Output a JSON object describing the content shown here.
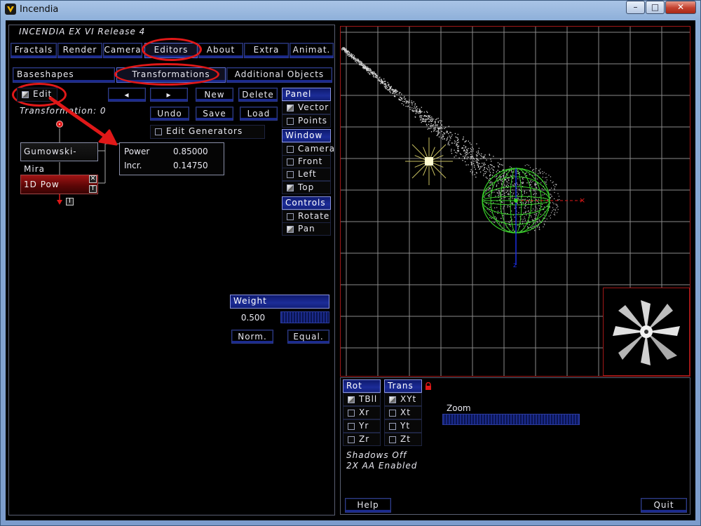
{
  "window": {
    "title": "Incendia",
    "minimize": "–",
    "maximize": "□",
    "close": "✕"
  },
  "app": {
    "title": "INCENDIA EX VI   Release 4"
  },
  "menu": [
    "Fractals",
    "Render",
    "Camera",
    "Editors",
    "About",
    "Extra",
    "Animat."
  ],
  "subtabs": [
    "Baseshapes",
    "Transformations",
    "Additional Objects"
  ],
  "toolbar": {
    "edit": "Edit",
    "prev": "◂",
    "next": "▸",
    "new": "New",
    "delete": "Delete",
    "undo": "Undo",
    "save": "Save",
    "load": "Load",
    "edit_generators": "Edit Generators"
  },
  "transformation": {
    "label": "Transformation: 0",
    "generator": "Gumowski-Mira",
    "node": "1D Pow",
    "node_x": "✕",
    "node_t": "T",
    "out_i": "I"
  },
  "params": {
    "power_label": "Power",
    "power_value": "0.85000",
    "incr_label": "Incr.",
    "incr_value": "0.14750"
  },
  "panel": {
    "header": "Panel",
    "items": [
      "Vector",
      "Points"
    ],
    "checked": [
      true,
      false
    ]
  },
  "window_group": {
    "header": "Window",
    "items": [
      "Camera",
      "Front",
      "Left",
      "Top"
    ],
    "checked": [
      false,
      false,
      false,
      true
    ]
  },
  "controls": {
    "header": "Controls",
    "items": [
      "Rotate",
      "Pan"
    ],
    "checked": [
      false,
      true
    ]
  },
  "weight": {
    "header": "Weight",
    "value": "0.500",
    "norm": "Norm.",
    "equal": "Equal."
  },
  "rot": {
    "header": "Rot",
    "items": [
      "TBll",
      "Xr",
      "Yr",
      "Zr"
    ],
    "checked": [
      true,
      false,
      false,
      false
    ]
  },
  "trans": {
    "header": "Trans",
    "items": [
      "XYt",
      "Xt",
      "Yt",
      "Zt"
    ],
    "checked": [
      true,
      false,
      false,
      false
    ]
  },
  "zoom": {
    "label": "Zoom"
  },
  "status": {
    "shadows": "Shadows Off",
    "aa": "2X AA Enabled"
  },
  "bottom": {
    "help": "Help",
    "quit": "Quit"
  },
  "colors": {
    "accent": "#1b2a8c",
    "highlight": "#e01818",
    "grid": "#8a8a8a",
    "sphere": "#39d12a"
  }
}
